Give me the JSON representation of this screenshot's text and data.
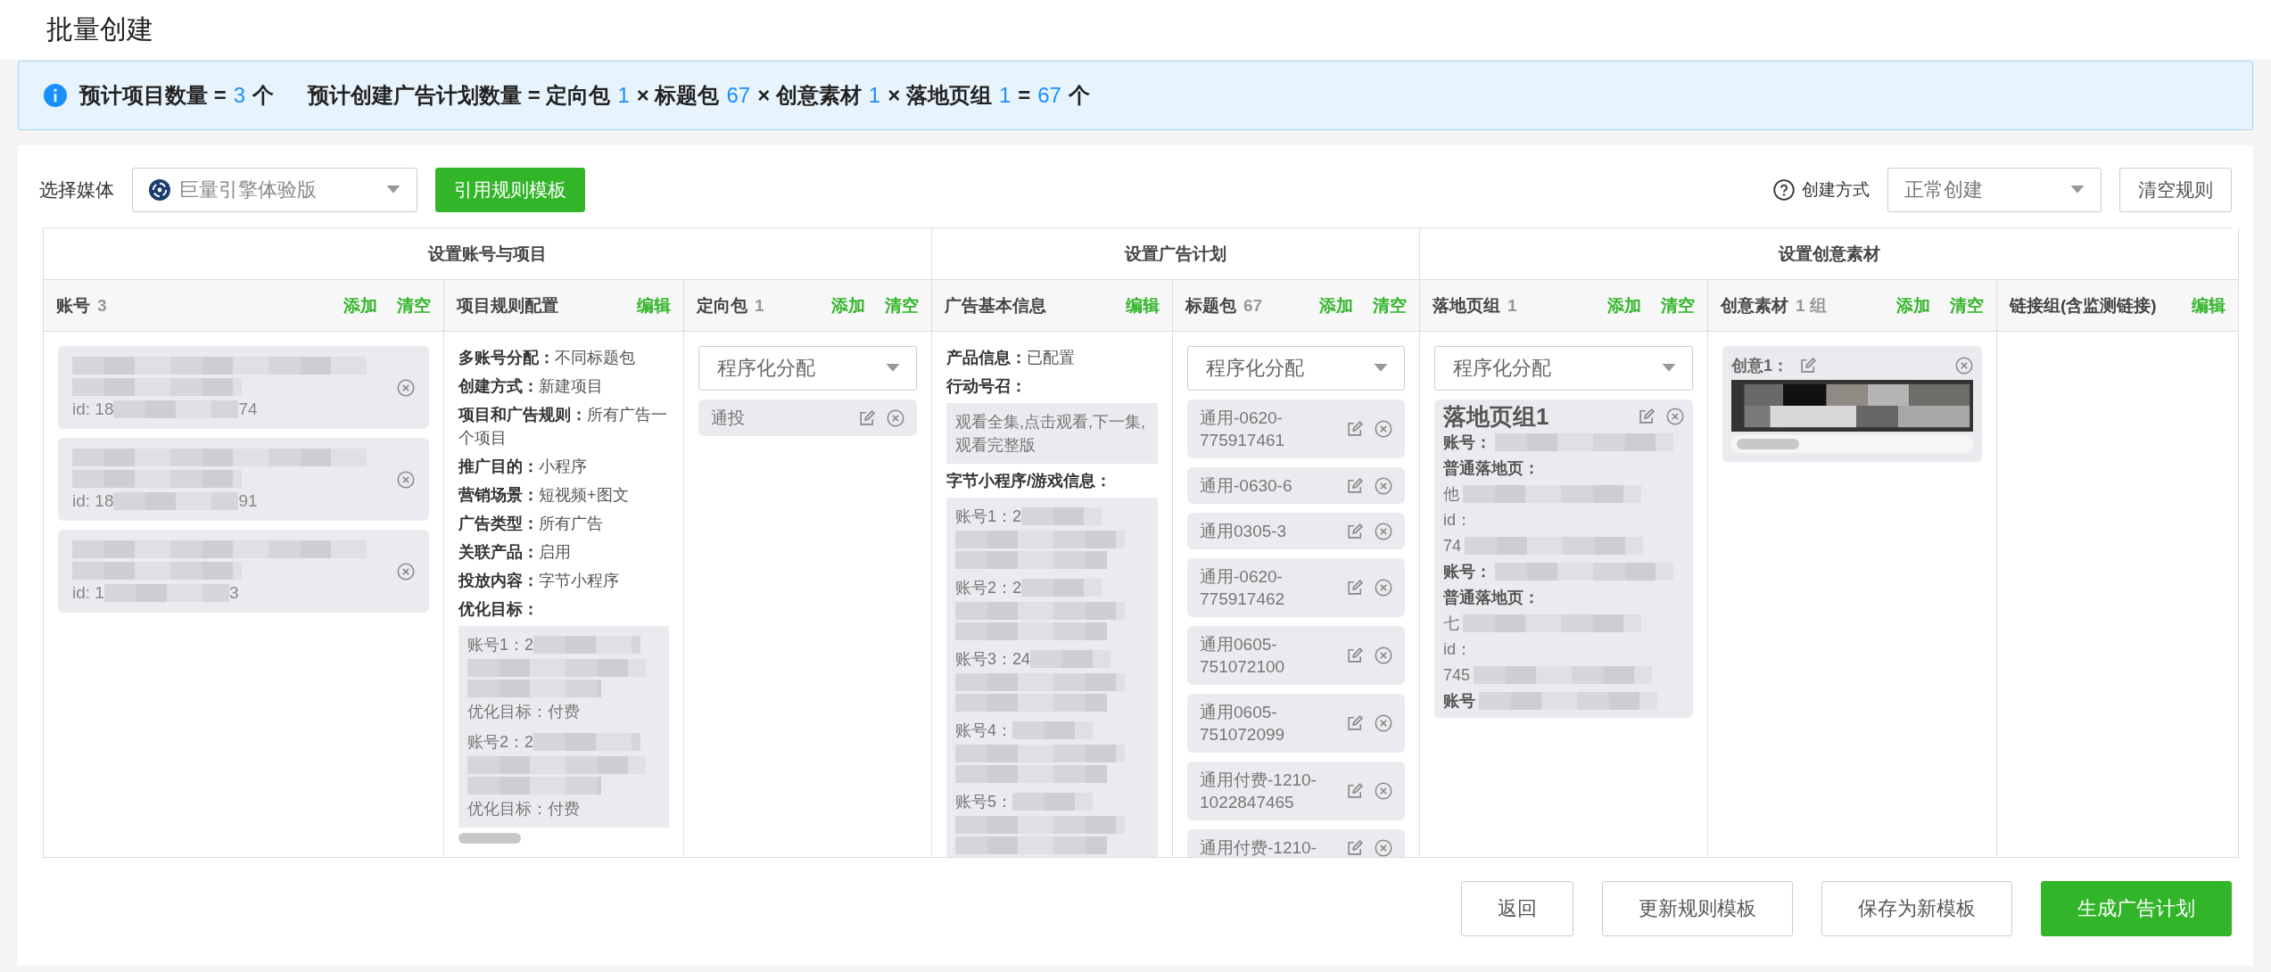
{
  "page_title": "批量创建",
  "summary": [
    {
      "kind": "text",
      "text": "预计项目数量 ="
    },
    {
      "kind": "number",
      "text": "3"
    },
    {
      "kind": "text",
      "text": "个"
    },
    {
      "kind": "gap"
    },
    {
      "kind": "text",
      "text": "预计创建广告计划数量 = 定向包"
    },
    {
      "kind": "number",
      "text": "1"
    },
    {
      "kind": "text",
      "text": "× 标题包"
    },
    {
      "kind": "number",
      "text": "67"
    },
    {
      "kind": "text",
      "text": "× 创意素材"
    },
    {
      "kind": "number",
      "text": "1"
    },
    {
      "kind": "text",
      "text": "× 落地页组"
    },
    {
      "kind": "number",
      "text": "1"
    },
    {
      "kind": "text",
      "text": "="
    },
    {
      "kind": "number",
      "text": "67"
    },
    {
      "kind": "text",
      "text": "个"
    }
  ],
  "toolbar": {
    "media_label": "选择媒体",
    "media_value": "巨量引擎体验版",
    "template_button": "引用规则模板",
    "mode_label": "创建方式",
    "mode_value": "正常创建",
    "clear_button": "清空规则"
  },
  "table": {
    "groups": [
      {
        "title": "设置账号与项目",
        "columns": [
          {
            "kind": "accounts",
            "title": "账号",
            "count": "3",
            "actions": [
              "添加",
              "清空"
            ],
            "items": [
              {
                "id_prefix": "id: 18",
                "id_suffix": "74"
              },
              {
                "id_prefix": "id: 18",
                "id_suffix": "91"
              },
              {
                "id_prefix": "id: 1",
                "id_suffix": "3"
              }
            ]
          },
          {
            "kind": "rules",
            "title": "项目规则配置",
            "actions": [
              "编辑"
            ],
            "rows": [
              {
                "label": "多账号分配：",
                "value": "不同标题包"
              },
              {
                "label": "创建方式：",
                "value": "新建项目"
              },
              {
                "label": "项目和广告规则：",
                "value": "所有广告一个项目"
              },
              {
                "label": "推广目的：",
                "value": "小程序"
              },
              {
                "label": "营销场景：",
                "value": "短视频+图文"
              },
              {
                "label": "广告类型：",
                "value": "所有广告"
              },
              {
                "label": "关联产品：",
                "value": "启用"
              },
              {
                "label": "投放内容：",
                "value": "字节小程序"
              }
            ],
            "goal_label": "优化目标：",
            "goals": [
              {
                "account": "账号1：2",
                "goal": "优化目标：付费"
              },
              {
                "account": "账号2：2",
                "goal": "优化目标：付费"
              }
            ]
          },
          {
            "kind": "targeting",
            "title": "定向包",
            "count": "1",
            "actions": [
              "添加",
              "清空"
            ],
            "select": "程序化分配",
            "items": [
              "通投"
            ]
          }
        ]
      },
      {
        "title": "设置广告计划",
        "columns": [
          {
            "kind": "ad_info",
            "title": "广告基本信息",
            "actions": [
              "编辑"
            ],
            "product_label": "产品信息：",
            "product_value": "已配置",
            "cta_label": "行动号召：",
            "cta_value": "观看全集,点击观看,下一集,观看完整版",
            "app_label": "字节小程序/游戏信息：",
            "app_accounts": [
              "账号1：2",
              "账号2：2",
              "账号3：24",
              "账号4：",
              "账号5："
            ]
          },
          {
            "kind": "titles",
            "title": "标题包",
            "count": "67",
            "actions": [
              "添加",
              "清空"
            ],
            "select": "程序化分配",
            "items": [
              "通用-0620-775917461",
              "通用-0630-6",
              "通用0305-3",
              "通用-0620-775917462",
              "通用0605-751072100",
              "通用0605-751072099",
              "通用付费-1210-1022847465",
              "通用付费-1210-"
            ]
          }
        ]
      },
      {
        "title": "设置创意素材",
        "columns": [
          {
            "kind": "landing",
            "title": "落地页组",
            "count": "1",
            "actions": [
              "添加",
              "清空"
            ],
            "select": "程序化分配",
            "group_title": "落地页组1",
            "lines": [
              {
                "kind": "label",
                "text": "账号：",
                "blurred": true
              },
              {
                "kind": "label",
                "text": "普通落地页：",
                "blurred": false
              },
              {
                "kind": "value",
                "text": "他",
                "blurred": true
              },
              {
                "kind": "value",
                "text": "id：",
                "blurred": false
              },
              {
                "kind": "value",
                "text": "74",
                "blurred": true
              },
              {
                "kind": "label",
                "text": "账号：",
                "blurred": true
              },
              {
                "kind": "label",
                "text": "普通落地页：",
                "blurred": false
              },
              {
                "kind": "value",
                "text": "七",
                "blurred": true
              },
              {
                "kind": "value",
                "text": "id：",
                "blurred": false
              },
              {
                "kind": "value",
                "text": "745",
                "blurred": true
              },
              {
                "kind": "label",
                "text": "账号",
                "blurred": true
              }
            ]
          },
          {
            "kind": "creative",
            "title": "创意素材",
            "count": "1 组",
            "actions": [
              "添加",
              "清空"
            ],
            "items": [
              {
                "label": "创意1："
              }
            ]
          },
          {
            "kind": "links",
            "title": "链接组(含监测链接)",
            "actions": [
              "编辑"
            ]
          }
        ]
      }
    ]
  },
  "footer_buttons": [
    {
      "label": "返回",
      "kind": "default"
    },
    {
      "label": "更新规则模板",
      "kind": "default"
    },
    {
      "label": "保存为新模板",
      "kind": "default"
    },
    {
      "label": "生成广告计划",
      "kind": "primary"
    }
  ]
}
